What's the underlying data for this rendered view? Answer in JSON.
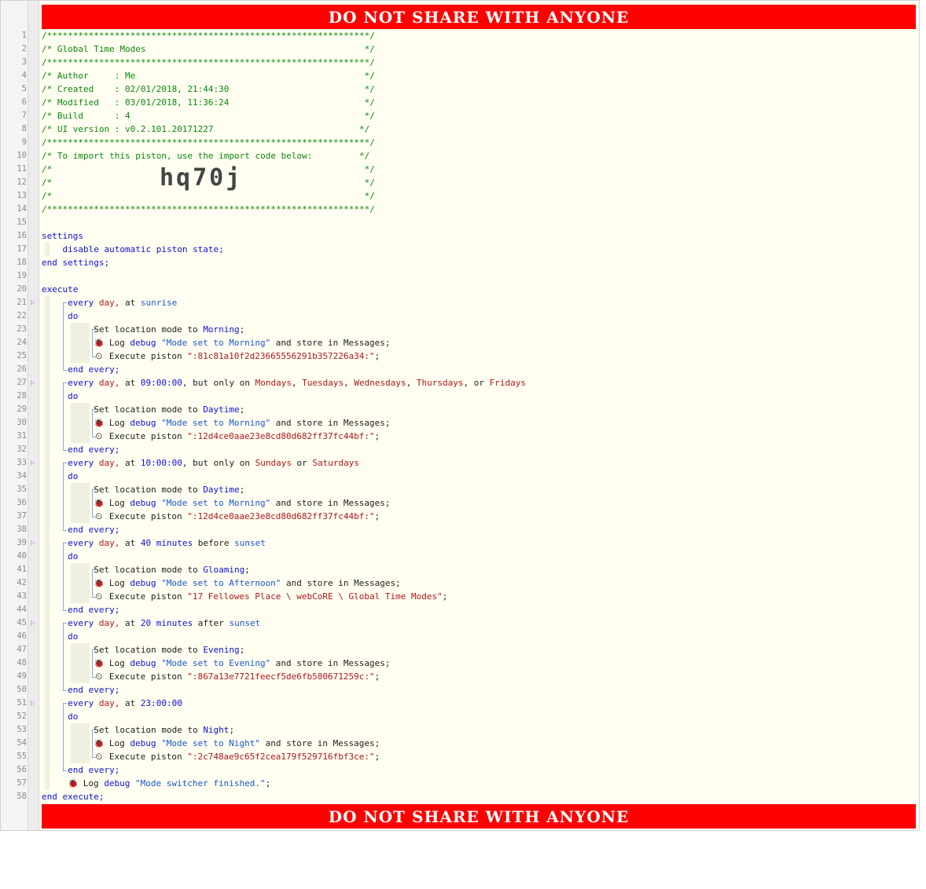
{
  "banner": {
    "text": "DO NOT SHARE WITH ANYONE"
  },
  "header": {
    "border": "/**************************************************************/",
    "title": "/* Global Time Modes                                          */",
    "author": "/* Author     : Me                                            */",
    "created": "/* Created    : 02/01/2018, 21:44:30                          */",
    "modified": "/* Modified   : 03/01/2018, 11:36:24                          */",
    "build": "/* Build      : 4                                             */",
    "ui_version": "/* UI version : v0.2.101.20171227                            */",
    "import_hint": "/* To import this piston, use the import code below:         */",
    "blank_comment": "/*                                                            */",
    "import_code": "hq70j"
  },
  "code": {
    "settings": "settings",
    "disable": "disable automatic piston state;",
    "end_settings": "end settings;",
    "execute": "execute",
    "end_execute": "end execute;",
    "final_log": "Log debug \"Mode switcher finished.\";",
    "blocks": [
      {
        "every": "every day,",
        "at": " at ",
        "time": "sunrise",
        "rest": "",
        "mode": "Morning",
        "log": "\"Mode set to Morning\"",
        "piston": "\":81c81a10f2d23665556291b357226a34:\""
      },
      {
        "every": "every day,",
        "at": " at ",
        "time": "09:00:00",
        "rest": ", but only on Mondays, Tuesdays, Wednesdays, Thursdays, or Fridays",
        "mode": "Daytime",
        "log": "\"Mode set to Morning\"",
        "piston": "\":12d4ce0aae23e8cd80d682ff37fc44bf:\""
      },
      {
        "every": "every day,",
        "at": " at ",
        "time": "10:00:00",
        "rest": ", but only on Sundays or Saturdays",
        "mode": "Daytime",
        "log": "\"Mode set to Morning\"",
        "piston": "\":12d4ce0aae23e8cd80d682ff37fc44bf:\""
      },
      {
        "every": "every day,",
        "at": " at ",
        "time": "40 minutes",
        "rest": " before sunset",
        "mode": "Gloaming",
        "log": "\"Mode set to Afternoon\"",
        "piston": "\"17 Fellowes Place \\ webCoRE \\ Global Time Modes\""
      },
      {
        "every": "every day,",
        "at": " at ",
        "time": "20 minutes",
        "rest": " after sunset",
        "mode": "Evening",
        "log": "\"Mode set to Evening\"",
        "piston": "\":867a13e7721feecf5de6fb580671259c:\""
      },
      {
        "every": "every day,",
        "at": " at ",
        "time": "23:00:00",
        "rest": "",
        "mode": "Night",
        "log": "\"Mode set to Night\"",
        "piston": "\":2c748ae9c65f2cea179f529716fbf3ce:\""
      }
    ]
  },
  "line_numbers": [
    "1",
    "2",
    "3",
    "4",
    "5",
    "6",
    "7",
    "8",
    "9",
    "10",
    "11",
    "12",
    "13",
    "14",
    "15",
    "16",
    "17",
    "18",
    "19",
    "20",
    "21",
    "22",
    "23",
    "24",
    "25",
    "26",
    "27",
    "28",
    "29",
    "30",
    "31",
    "32",
    "33",
    "34",
    "35",
    "36",
    "37",
    "38",
    "39",
    "40",
    "41",
    "42",
    "43",
    "44",
    "45",
    "46",
    "47",
    "48",
    "49",
    "50",
    "51",
    "52",
    "53",
    "54",
    "55",
    "56",
    "57",
    "58"
  ],
  "flag_lines": [
    "21",
    "27",
    "33",
    "39",
    "45",
    "51"
  ],
  "colors": {
    "banner": "#ff0000",
    "comment": "#0a8a0a",
    "keyword": "#1010d8",
    "value": "#b01818",
    "string": "#1a56c8",
    "background": "#fffef1"
  }
}
